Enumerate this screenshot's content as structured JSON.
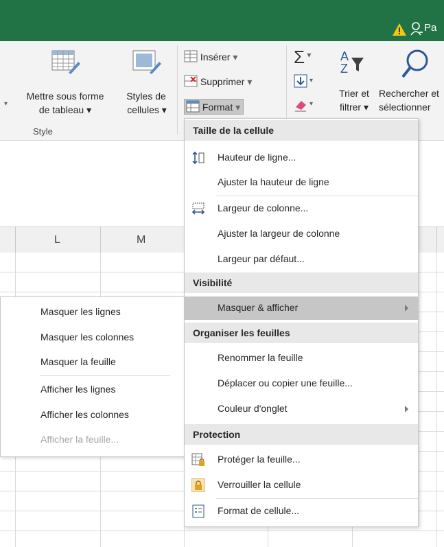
{
  "titlebar": {
    "user_initials": "Pa"
  },
  "ribbon": {
    "format_as_table": [
      "Mettre sous forme",
      "de tableau"
    ],
    "cell_styles": [
      "Styles de",
      "cellules"
    ],
    "insert": "Insérer",
    "delete": "Supprimer",
    "format": "Format",
    "sort_filter": [
      "Trier et",
      "filtrer"
    ],
    "find_select": [
      "Rechercher et",
      "sélectionner"
    ],
    "style_group": "Style"
  },
  "columns": [
    "L",
    "M"
  ],
  "menu": {
    "sections": [
      {
        "header": "Taille de la cellule",
        "items": [
          {
            "label": "Hauteur de ligne...",
            "icon": "row-height-icon"
          },
          {
            "label": "Ajuster la hauteur de ligne"
          },
          {
            "label": "Largeur de colonne...",
            "icon": "column-width-icon"
          },
          {
            "label": "Ajuster la largeur de colonne"
          },
          {
            "label": "Largeur par défaut..."
          }
        ]
      },
      {
        "header": "Visibilité",
        "items": [
          {
            "label": "Masquer & afficher",
            "submenu": true,
            "active": true
          }
        ]
      },
      {
        "header": "Organiser les feuilles",
        "items": [
          {
            "label": "Renommer la feuille"
          },
          {
            "label": "Déplacer ou copier une feuille..."
          },
          {
            "label": "Couleur d'onglet",
            "submenu": true
          }
        ]
      },
      {
        "header": "Protection",
        "items": [
          {
            "label": "Protéger la feuille...",
            "icon": "protect-sheet-icon"
          },
          {
            "label": "Verrouiller la cellule",
            "icon": "lock-icon"
          },
          {
            "label": "Format de cellule...",
            "icon": "format-cells-icon"
          }
        ]
      }
    ]
  },
  "submenu": {
    "items": [
      {
        "label": "Masquer les lignes"
      },
      {
        "label": "Masquer les colonnes"
      },
      {
        "label": "Masquer la feuille"
      },
      {
        "label": "Afficher les lignes"
      },
      {
        "label": "Afficher les colonnes"
      },
      {
        "label": "Afficher la feuille...",
        "disabled": true
      }
    ]
  },
  "colors": {
    "title_bar": "#217346",
    "ribbon_bg": "#f3f3f3",
    "menu_header_bg": "#e8e8e8",
    "active_item_bg": "#c6c6c6",
    "disabled_text": "#a6a6a6"
  }
}
